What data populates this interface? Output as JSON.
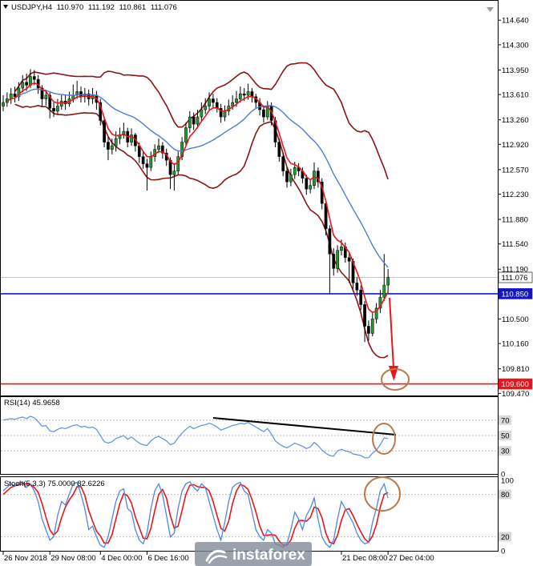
{
  "colors": {
    "background": "#ffffff",
    "bull": "#1e9a2e",
    "bear": "#000000",
    "band": "#8b1414",
    "ma_slow": "#4a7ed6",
    "ma_fast": "#e8161b",
    "rsi": "#5b8fe0",
    "annotation": "#b87a4b",
    "frame": "#000000"
  },
  "watermark": "instaforex",
  "chart_data": [
    {
      "type": "bar",
      "title": "USDJPY,H4",
      "quote": [
        "110.970",
        "111.192",
        "110.861",
        "111.076"
      ],
      "ylim": [
        109.44,
        114.92
      ],
      "yticks": [
        114.64,
        114.3,
        113.95,
        113.61,
        113.26,
        112.92,
        112.57,
        112.23,
        111.88,
        111.54,
        111.19,
        110.5,
        110.16,
        109.81,
        109.47
      ],
      "last_price": 111.076,
      "hlines": [
        {
          "value": 110.85,
          "color": "#1515c8"
        },
        {
          "value": 109.6,
          "color": "#e8161b"
        }
      ],
      "xticks": [
        {
          "label": "26 Nov 2018",
          "bar": 0
        },
        {
          "label": "29 Nov 08:00",
          "bar": 12
        },
        {
          "label": "4 Dec 00:00",
          "bar": 25
        },
        {
          "label": "6 Dec 16:00",
          "bar": 37
        },
        {
          "label": "21 Dec 08:00",
          "bar": 87
        },
        {
          "label": "27 Dec 04:00",
          "bar": 99
        }
      ],
      "ohlc": [
        [
          113.45,
          113.6,
          113.38,
          113.5
        ],
        [
          113.5,
          113.64,
          113.44,
          113.55
        ],
        [
          113.55,
          113.7,
          113.48,
          113.62
        ],
        [
          113.62,
          113.72,
          113.5,
          113.58
        ],
        [
          113.58,
          113.78,
          113.52,
          113.7
        ],
        [
          113.7,
          113.88,
          113.64,
          113.78
        ],
        [
          113.78,
          113.9,
          113.66,
          113.74
        ],
        [
          113.74,
          113.96,
          113.7,
          113.86
        ],
        [
          113.86,
          113.95,
          113.74,
          113.82
        ],
        [
          113.82,
          113.88,
          113.62,
          113.7
        ],
        [
          113.7,
          113.74,
          113.45,
          113.55
        ],
        [
          113.55,
          113.68,
          113.46,
          113.6
        ],
        [
          113.6,
          113.64,
          113.28,
          113.42
        ],
        [
          113.42,
          113.5,
          113.3,
          113.38
        ],
        [
          113.38,
          113.55,
          113.34,
          113.45
        ],
        [
          113.45,
          113.6,
          113.4,
          113.52
        ],
        [
          113.52,
          113.6,
          113.4,
          113.48
        ],
        [
          113.48,
          113.65,
          113.44,
          113.55
        ],
        [
          113.55,
          113.75,
          113.5,
          113.6
        ],
        [
          113.6,
          113.8,
          113.55,
          113.65
        ],
        [
          113.65,
          113.72,
          113.5,
          113.58
        ],
        [
          113.58,
          113.7,
          113.5,
          113.62
        ],
        [
          113.62,
          113.68,
          113.46,
          113.55
        ],
        [
          113.55,
          113.7,
          113.48,
          113.6
        ],
        [
          113.6,
          113.66,
          113.4,
          113.5
        ],
        [
          113.5,
          113.55,
          113.18,
          113.25
        ],
        [
          113.25,
          113.3,
          112.88,
          112.95
        ],
        [
          112.95,
          113.02,
          112.7,
          112.85
        ],
        [
          112.85,
          113.0,
          112.78,
          112.9
        ],
        [
          112.9,
          113.1,
          112.82,
          113.0
        ],
        [
          113.0,
          113.15,
          112.92,
          113.05
        ],
        [
          113.05,
          113.22,
          113.0,
          113.1
        ],
        [
          113.1,
          113.15,
          112.88,
          112.95
        ],
        [
          112.95,
          113.14,
          112.9,
          113.05
        ],
        [
          113.05,
          113.08,
          112.82,
          112.9
        ],
        [
          112.9,
          112.95,
          112.66,
          112.75
        ],
        [
          112.75,
          112.82,
          112.58,
          112.65
        ],
        [
          112.65,
          112.72,
          112.28,
          112.6
        ],
        [
          112.6,
          112.82,
          112.55,
          112.75
        ],
        [
          112.75,
          112.92,
          112.68,
          112.85
        ],
        [
          112.85,
          113.0,
          112.8,
          112.9
        ],
        [
          112.9,
          112.95,
          112.72,
          112.8
        ],
        [
          112.8,
          112.86,
          112.62,
          112.7
        ],
        [
          112.7,
          112.74,
          112.3,
          112.5
        ],
        [
          112.5,
          112.66,
          112.28,
          112.55
        ],
        [
          112.55,
          112.82,
          112.5,
          112.75
        ],
        [
          112.75,
          113.02,
          112.7,
          112.95
        ],
        [
          112.95,
          113.22,
          112.9,
          113.15
        ],
        [
          113.15,
          113.38,
          113.08,
          113.3
        ],
        [
          113.3,
          113.36,
          113.12,
          113.2
        ],
        [
          113.2,
          113.4,
          113.14,
          113.3
        ],
        [
          113.3,
          113.5,
          113.24,
          113.4
        ],
        [
          113.4,
          113.56,
          113.34,
          113.45
        ],
        [
          113.45,
          113.64,
          113.4,
          113.55
        ],
        [
          113.55,
          113.62,
          113.42,
          113.5
        ],
        [
          113.5,
          113.56,
          113.36,
          113.42
        ],
        [
          113.42,
          113.48,
          113.22,
          113.3
        ],
        [
          113.3,
          113.46,
          113.24,
          113.38
        ],
        [
          113.38,
          113.54,
          113.32,
          113.45
        ],
        [
          113.45,
          113.6,
          113.4,
          113.5
        ],
        [
          113.5,
          113.66,
          113.44,
          113.55
        ],
        [
          113.55,
          113.72,
          113.5,
          113.62
        ],
        [
          113.62,
          113.7,
          113.52,
          113.6
        ],
        [
          113.6,
          113.76,
          113.54,
          113.65
        ],
        [
          113.65,
          113.7,
          113.5,
          113.58
        ],
        [
          113.58,
          113.62,
          113.42,
          113.5
        ],
        [
          113.5,
          113.56,
          113.32,
          113.4
        ],
        [
          113.4,
          113.46,
          113.22,
          113.3
        ],
        [
          113.3,
          113.52,
          113.26,
          113.45
        ],
        [
          113.45,
          113.5,
          113.18,
          113.25
        ],
        [
          113.25,
          113.3,
          112.88,
          112.95
        ],
        [
          112.95,
          113.0,
          112.68,
          112.75
        ],
        [
          112.75,
          112.8,
          112.48,
          112.55
        ],
        [
          112.55,
          112.6,
          112.32,
          112.4
        ],
        [
          112.4,
          112.58,
          112.34,
          112.5
        ],
        [
          112.5,
          112.68,
          112.44,
          112.6
        ],
        [
          112.6,
          112.66,
          112.48,
          112.55
        ],
        [
          112.55,
          112.6,
          112.38,
          112.45
        ],
        [
          112.45,
          112.5,
          112.22,
          112.3
        ],
        [
          112.3,
          112.44,
          112.24,
          112.35
        ],
        [
          112.35,
          112.67,
          112.3,
          112.55
        ],
        [
          112.55,
          112.6,
          112.32,
          112.4
        ],
        [
          112.4,
          112.45,
          112.02,
          112.1
        ],
        [
          112.1,
          112.15,
          111.66,
          111.75
        ],
        [
          111.75,
          111.8,
          110.84,
          111.4
        ],
        [
          111.4,
          111.48,
          111.1,
          111.2
        ],
        [
          111.2,
          111.52,
          111.14,
          111.45
        ],
        [
          111.45,
          111.6,
          111.38,
          111.5
        ],
        [
          111.5,
          111.56,
          111.28,
          111.35
        ],
        [
          111.35,
          111.42,
          111.0,
          111.3
        ],
        [
          111.3,
          111.34,
          110.92,
          111.0
        ],
        [
          111.0,
          111.08,
          110.82,
          110.9
        ],
        [
          110.9,
          110.96,
          110.62,
          110.7
        ],
        [
          110.7,
          110.75,
          110.18,
          110.4
        ],
        [
          110.4,
          110.48,
          110.2,
          110.3
        ],
        [
          110.3,
          110.58,
          110.26,
          110.5
        ],
        [
          110.5,
          110.72,
          110.44,
          110.65
        ],
        [
          110.65,
          110.9,
          110.58,
          110.8
        ],
        [
          110.8,
          111.4,
          110.75,
          110.97
        ],
        [
          110.97,
          111.192,
          110.861,
          111.076
        ]
      ]
    },
    {
      "type": "line",
      "title": "RSI(14) 45.9658",
      "ylim": [
        0,
        100
      ],
      "yticks": [
        70,
        50,
        30,
        0
      ],
      "levels": [
        70,
        50,
        30
      ],
      "series": [
        {
          "values": [
            70,
            71,
            72,
            71,
            73,
            74,
            72,
            75,
            73,
            68,
            62,
            63,
            56,
            55,
            58,
            60,
            59,
            61,
            63,
            64,
            61,
            62,
            60,
            61,
            58,
            50,
            42,
            40,
            42,
            46,
            48,
            50,
            45,
            48,
            44,
            40,
            38,
            37,
            43,
            47,
            49,
            46,
            43,
            38,
            40,
            47,
            53,
            58,
            62,
            59,
            61,
            63,
            64,
            66,
            64,
            61,
            57,
            59,
            61,
            63,
            64,
            66,
            65,
            67,
            64,
            61,
            58,
            55,
            59,
            52,
            43,
            39,
            36,
            34,
            37,
            40,
            38,
            36,
            33,
            35,
            41,
            37,
            31,
            27,
            24,
            23,
            30,
            32,
            30,
            29,
            26,
            25,
            24,
            21,
            21,
            27,
            31,
            38,
            47,
            45.97
          ]
        }
      ]
    },
    {
      "type": "line",
      "title": "Stoch(5,3,3) 75.0000 82.6226",
      "ylim": [
        0,
        100
      ],
      "yticks": [
        100,
        80,
        20,
        0
      ],
      "levels": [
        80,
        20
      ],
      "series": [
        {
          "color": "#4f86e0",
          "values": [
            85,
            90,
            95,
            92,
            96,
            98,
            90,
            95,
            85,
            70,
            45,
            30,
            15,
            20,
            50,
            70,
            65,
            80,
            95,
            97,
            80,
            60,
            30,
            35,
            20,
            8,
            5,
            20,
            45,
            70,
            85,
            88,
            60,
            55,
            30,
            15,
            10,
            25,
            60,
            85,
            95,
            80,
            50,
            20,
            25,
            60,
            85,
            95,
            98,
            90,
            85,
            95,
            90,
            70,
            50,
            30,
            15,
            40,
            70,
            90,
            95,
            97,
            85,
            80,
            55,
            30,
            20,
            15,
            30,
            25,
            10,
            8,
            5,
            10,
            30,
            55,
            45,
            30,
            50,
            60,
            75,
            45,
            20,
            10,
            5,
            15,
            45,
            70,
            60,
            50,
            40,
            25,
            15,
            10,
            12,
            40,
            60,
            85,
            95,
            75
          ]
        },
        {
          "color": "#e8161b",
          "values": [
            80,
            85,
            90,
            92,
            94,
            95,
            95,
            94,
            90,
            83,
            67,
            48,
            30,
            22,
            28,
            47,
            62,
            72,
            80,
            91,
            91,
            79,
            57,
            42,
            28,
            21,
            11,
            11,
            23,
            45,
            67,
            81,
            78,
            68,
            48,
            33,
            18,
            17,
            32,
            57,
            80,
            87,
            75,
            50,
            32,
            35,
            57,
            80,
            93,
            94,
            91,
            90,
            90,
            85,
            70,
            50,
            32,
            28,
            42,
            67,
            85,
            94,
            92,
            87,
            73,
            55,
            35,
            22,
            22,
            23,
            22,
            14,
            8,
            8,
            15,
            32,
            43,
            43,
            42,
            47,
            62,
            60,
            47,
            25,
            12,
            10,
            22,
            43,
            58,
            60,
            50,
            38,
            27,
            17,
            12,
            21,
            37,
            62,
            80,
            82.62
          ]
        }
      ]
    }
  ]
}
